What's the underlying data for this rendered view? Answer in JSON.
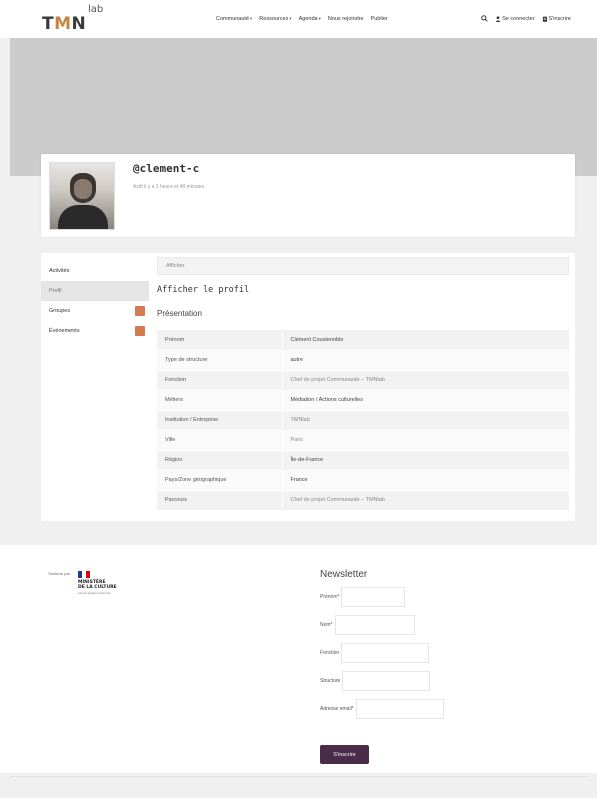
{
  "logo": {
    "tmn": "TMN",
    "lab": "lab"
  },
  "nav": {
    "items": [
      {
        "label": "Communauté",
        "caret": "▾"
      },
      {
        "label": "Ressources",
        "caret": "▾"
      },
      {
        "label": "Agenda",
        "caret": "▾"
      },
      {
        "label": "Nous rejoindre",
        "caret": ""
      },
      {
        "label": "Publier",
        "caret": ""
      }
    ],
    "login_label": "Se connecter",
    "signup_label": "S'inscrire"
  },
  "profile": {
    "handle": "@clement-c",
    "active": "Actif il y a 1 heure et 49 minutes"
  },
  "sidebar": {
    "items": [
      {
        "label": "Activités"
      },
      {
        "label": "Profil"
      },
      {
        "label": "Groupes"
      },
      {
        "label": "Événements"
      }
    ]
  },
  "main": {
    "tab_label": "Afficher",
    "title": "Afficher le profil",
    "subtitle": "Présentation",
    "rows": [
      {
        "key": "Prénom",
        "value": "Clément Coustenoble"
      },
      {
        "key": "Type de structure",
        "value": "autre"
      },
      {
        "key": "Fonction",
        "value": "Chef de projet Communauté – TMNlab"
      },
      {
        "key": "Métiers",
        "value": "Médiation / Actions culturelles"
      },
      {
        "key": "Institution / Entreprise",
        "value": "TMNlab"
      },
      {
        "key": "Ville",
        "value": "Paris"
      },
      {
        "key": "Région",
        "value": "Île-de-France"
      },
      {
        "key": "Pays/Zone géographique",
        "value": "France"
      },
      {
        "key": "Parcours",
        "value": "Chef de projet Communauté – TMNlab"
      }
    ]
  },
  "footer": {
    "supported_by": "Soutenu par",
    "ministry_line1": "MINISTÈRE",
    "ministry_line2": "DE LA CULTURE",
    "ministry_motto": "Liberté Égalité Fraternité",
    "newsletter": {
      "title": "Newsletter",
      "fields": [
        {
          "label": "Prénom*"
        },
        {
          "label": "Nom*"
        },
        {
          "label": "Fonction"
        },
        {
          "label": "Structure"
        },
        {
          "label": "Adresse email*"
        }
      ],
      "button": "S'inscrire"
    }
  },
  "colors": {
    "accent": "#d47a52",
    "button": "#4a2c4a",
    "banner": "#cccccc"
  }
}
